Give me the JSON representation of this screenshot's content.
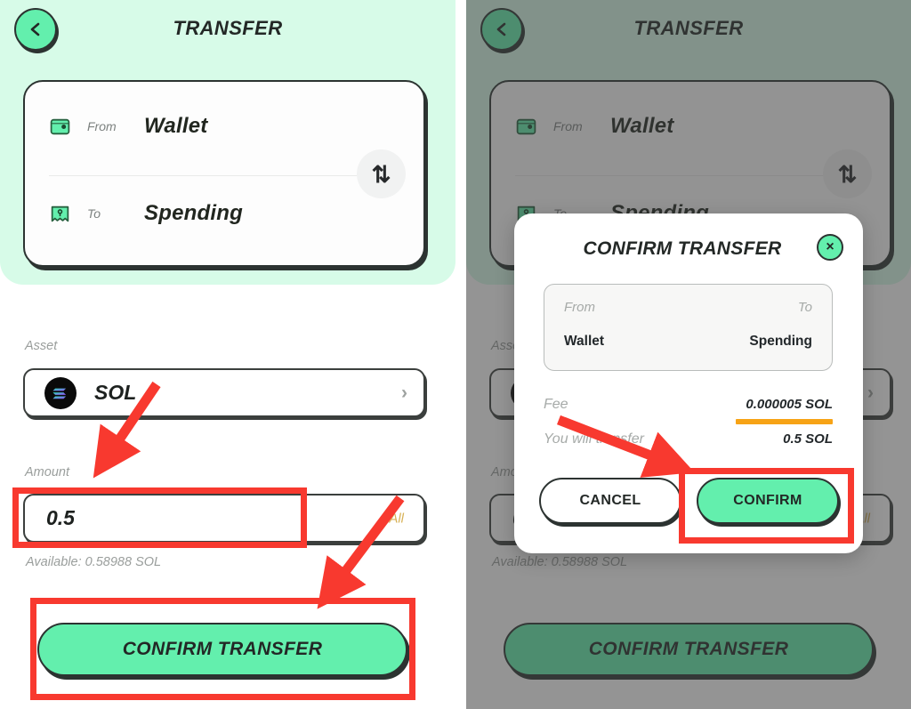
{
  "app": {
    "screen_title": "TRANSFER",
    "back_icon": "chevron-left-icon"
  },
  "transfer_card": {
    "from_label": "From",
    "from_value": "Wallet",
    "from_icon": "wallet-icon",
    "to_label": "To",
    "to_value": "Spending",
    "to_icon": "spending-tag-icon",
    "swap_icon": "⇅"
  },
  "asset": {
    "label": "Asset",
    "value": "SOL",
    "logo_icon": "solana-logo-icon",
    "chevron": "›"
  },
  "amount": {
    "label": "Amount",
    "value": "0.5",
    "all_label": "All",
    "available": "Available: 0.58988  SOL"
  },
  "cta": {
    "label": "CONFIRM TRANSFER"
  },
  "modal": {
    "title": "CONFIRM TRANSFER",
    "close_icon": "×",
    "from_label": "From",
    "from_value": "Wallet",
    "to_label": "To",
    "to_value": "Spending",
    "fee_label": "Fee",
    "fee_value": "0.000005 SOL",
    "transfer_label": "You will transfer",
    "transfer_value": "0.5 SOL",
    "cancel_label": "CANCEL",
    "confirm_label": "CONFIRM"
  },
  "colors": {
    "mint_header": "#d7fbe8",
    "accent_green": "#63efad",
    "dark_green_dim": "#1f7d56",
    "ink": "#2c3331",
    "fee_bar": "#f7a316",
    "all_gold": "#d8b257",
    "annotation_red": "#f8392f"
  }
}
